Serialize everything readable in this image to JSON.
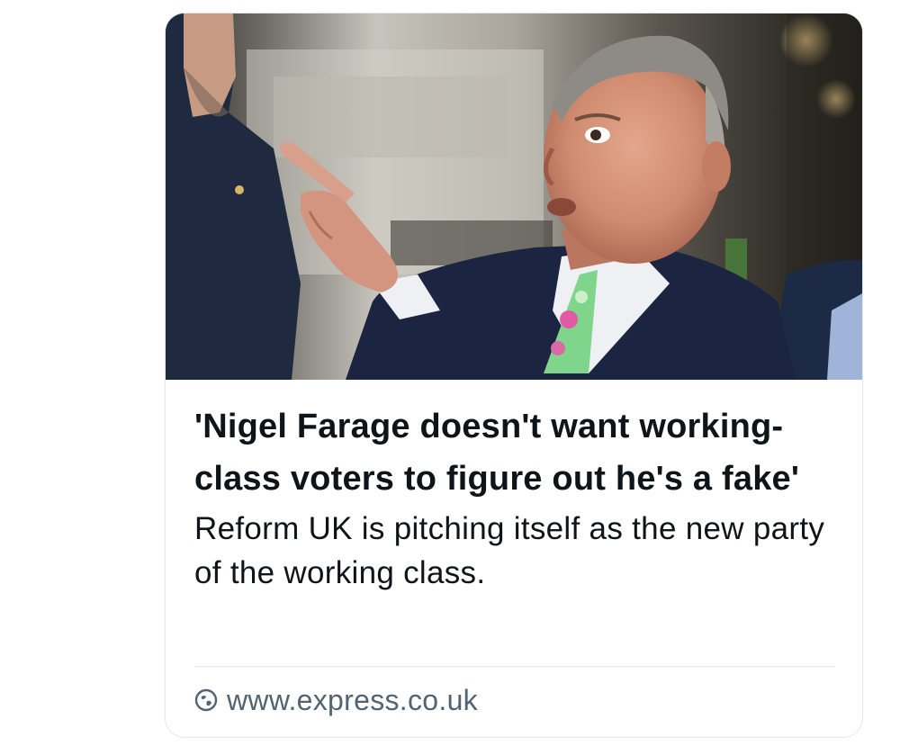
{
  "card": {
    "image": {
      "alt_icon": "news-photo",
      "description_icon": "man-pointing-photo"
    },
    "headline": "'Nigel Farage doesn't want working-class voters to figure out he's a fake'",
    "description": "Reform UK is pitching itself as the new party of the working class.",
    "link": {
      "icon": "link-globe-icon",
      "url": "www.express.co.uk"
    }
  },
  "colors": {
    "text_primary": "#0f1419",
    "text_secondary": "#536471",
    "border": "#e3e7eb"
  }
}
